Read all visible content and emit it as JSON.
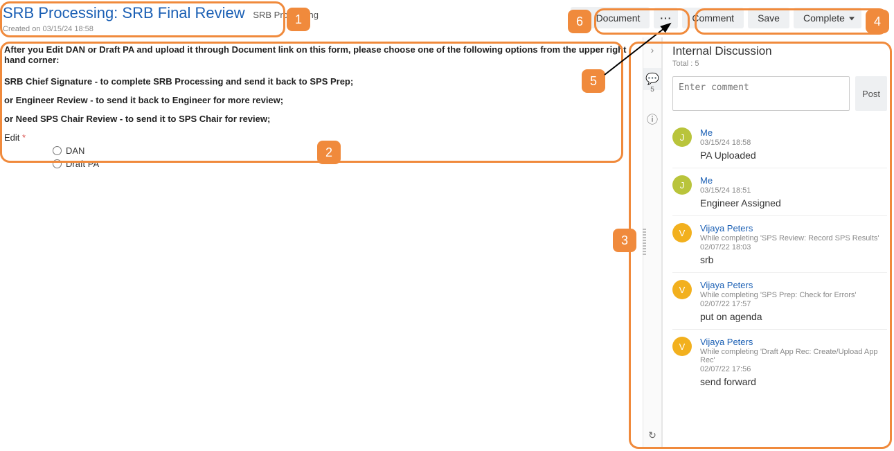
{
  "header": {
    "title": "SRB Processing: SRB Final Review",
    "subtitle": "SRB Processing",
    "created_on": "Created on 03/15/24 18:58",
    "document_btn": "Document",
    "comment_btn": "Comment",
    "save_btn": "Save",
    "complete_btn": "Complete"
  },
  "instructions": {
    "line1": "After you Edit DAN or Draft PA and upload it through Document link on this form, please choose one of the following options from the upper right hand corner:",
    "line2": "SRB Chief Signature - to complete SRB Processing and send it back to SPS Prep;",
    "line3": "or Engineer Review - to send it back to Engineer for more review;",
    "line4": "or Need SPS Chair Review - to send it to SPS Chair for review;"
  },
  "edit_field": {
    "label": "Edit",
    "required": "*",
    "opt_dan": "DAN",
    "opt_draft_pa": "Draft PA"
  },
  "rail": {
    "comment_count": "5"
  },
  "panel": {
    "title": "Internal Discussion",
    "total_label": "Total : 5",
    "comment_placeholder": "Enter comment",
    "post_btn": "Post"
  },
  "comments": [
    {
      "avatar_letter": "J",
      "avatar_class": "j",
      "author": "Me",
      "context": "",
      "time": "03/15/24 18:58",
      "text": "PA Uploaded"
    },
    {
      "avatar_letter": "J",
      "avatar_class": "j",
      "author": "Me",
      "context": "",
      "time": "03/15/24 18:51",
      "text": "Engineer Assigned"
    },
    {
      "avatar_letter": "V",
      "avatar_class": "v",
      "author": "Vijaya Peters",
      "context": "While completing 'SPS Review: Record SPS Results'",
      "time": "02/07/22 18:03",
      "text": "srb"
    },
    {
      "avatar_letter": "V",
      "avatar_class": "v",
      "author": "Vijaya Peters",
      "context": "While completing 'SPS Prep: Check for Errors'",
      "time": "02/07/22 17:57",
      "text": "put on agenda"
    },
    {
      "avatar_letter": "V",
      "avatar_class": "v",
      "author": "Vijaya Peters",
      "context": "While completing 'Draft App Rec: Create/Upload App Rec'",
      "time": "02/07/22 17:56",
      "text": "send forward"
    }
  ],
  "annotations": {
    "b1": "1",
    "b2": "2",
    "b3": "3",
    "b4": "4",
    "b5": "5",
    "b6": "6"
  }
}
